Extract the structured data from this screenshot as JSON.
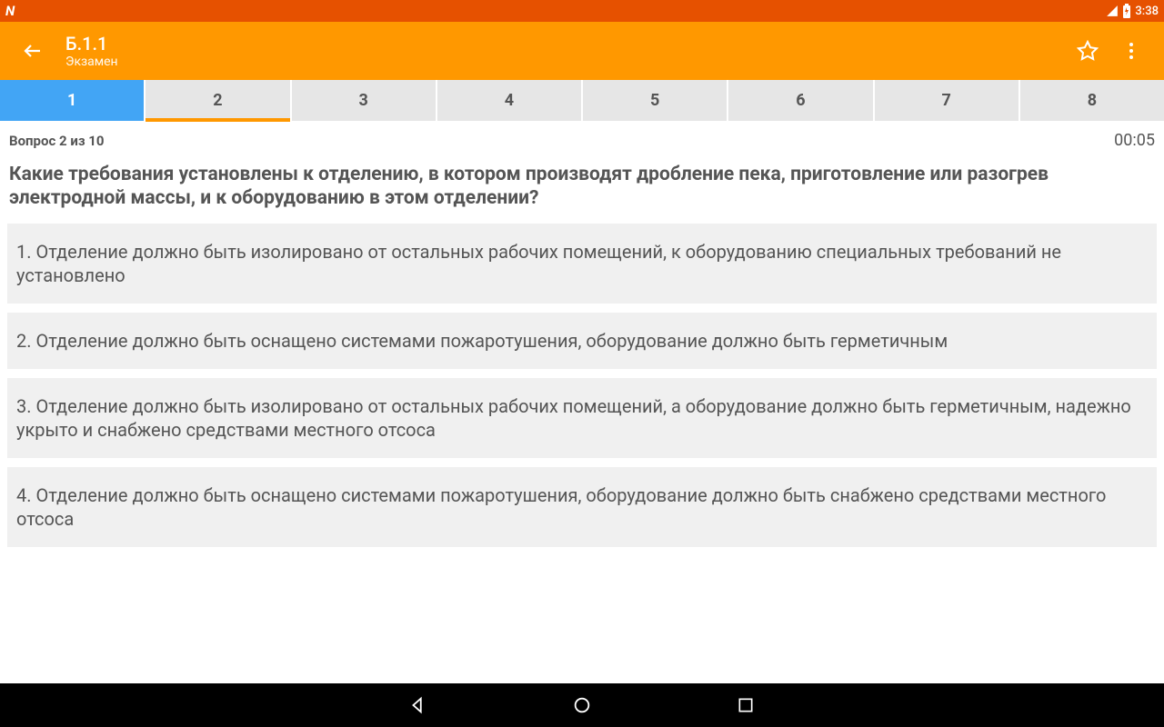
{
  "status": {
    "logo": "N",
    "time": "3:38"
  },
  "appbar": {
    "title": "Б.1.1",
    "subtitle": "Экзамен"
  },
  "tabs": [
    "1",
    "2",
    "3",
    "4",
    "5",
    "6",
    "7",
    "8"
  ],
  "selected_tab_index": 0,
  "underlined_tab_index": 1,
  "info": {
    "progress": "Вопрос 2 из 10",
    "timer": "00:05"
  },
  "question": "Какие требования установлены к отделению, в котором производят дробление пека, приготовление или разогрев электродной массы, и к оборудованию в этом отделении?",
  "answers": [
    "1. Отделение должно быть изолировано от остальных рабочих помещений, к оборудованию специальных требований не установлено",
    "2. Отделение должно быть оснащено системами пожаротушения, оборудование должно быть герметичным",
    "3. Отделение должно быть изолировано от остальных рабочих помещений, а оборудование должно быть герметичным, надежно укрыто и снабжено средствами местного отсоса",
    "4. Отделение должно быть оснащено системами пожаротушения, оборудование должно быть снабжено средствами местного отсоса"
  ]
}
